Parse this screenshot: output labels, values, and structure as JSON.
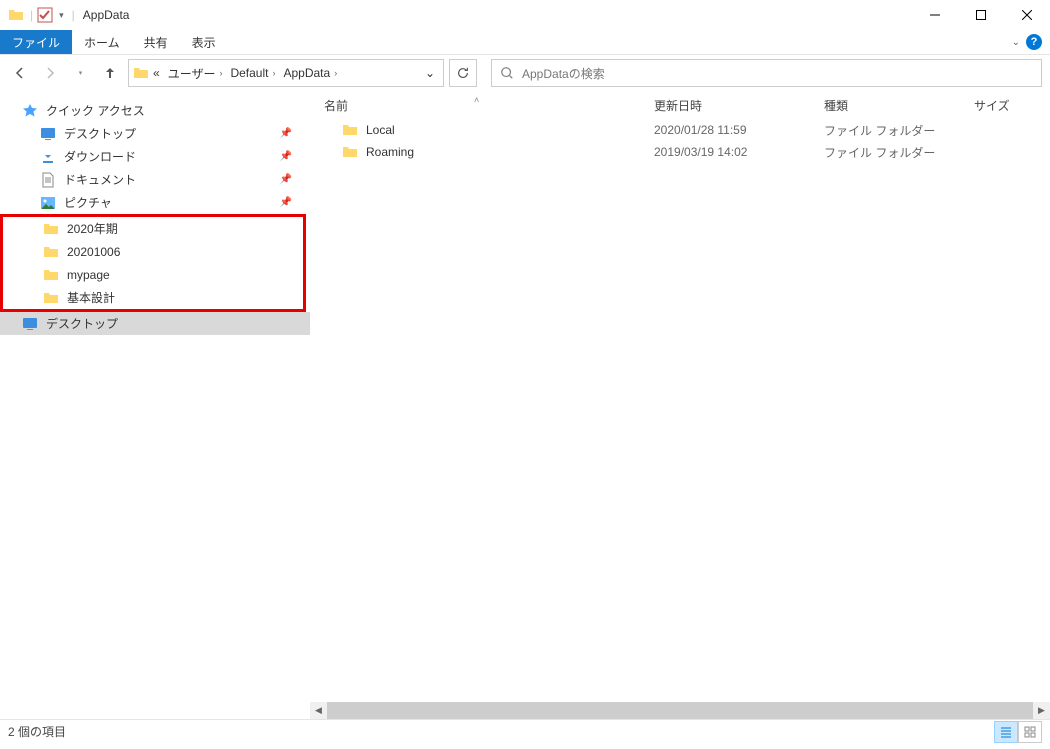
{
  "window": {
    "title": "AppData"
  },
  "ribbon": {
    "file": "ファイル",
    "tabs": [
      "ホーム",
      "共有",
      "表示"
    ]
  },
  "breadcrumb": {
    "prefix": "«",
    "items": [
      "ユーザー",
      "Default",
      "AppData"
    ]
  },
  "search": {
    "placeholder": "AppDataの検索"
  },
  "sidebar": {
    "quick_access": "クイック アクセス",
    "items": [
      {
        "icon": "desktop",
        "label": "デスクトップ",
        "pinned": true
      },
      {
        "icon": "download",
        "label": "ダウンロード",
        "pinned": true
      },
      {
        "icon": "document",
        "label": "ドキュメント",
        "pinned": true
      },
      {
        "icon": "picture",
        "label": "ピクチャ",
        "pinned": true
      }
    ],
    "highlighted": [
      {
        "label": "2020年期"
      },
      {
        "label": "20201006"
      },
      {
        "label": "mypage"
      },
      {
        "label": "基本設計"
      }
    ],
    "desktop_section": "デスクトップ"
  },
  "columns": {
    "name": "名前",
    "date": "更新日時",
    "type": "種類",
    "size": "サイズ"
  },
  "files": [
    {
      "name": "Local",
      "date": "2020/01/28 11:59",
      "type": "ファイル フォルダー"
    },
    {
      "name": "Roaming",
      "date": "2019/03/19 14:02",
      "type": "ファイル フォルダー"
    }
  ],
  "status": {
    "text": "2 個の項目"
  }
}
